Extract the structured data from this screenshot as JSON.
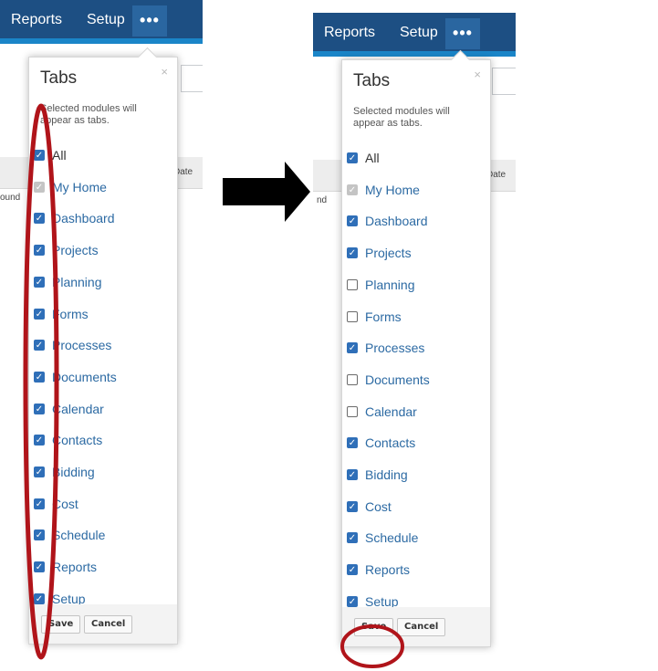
{
  "colors": {
    "navbar": "#1d4f83",
    "navbar_stripe": "#1a85c8",
    "checkbox_checked": "#2f6fb8",
    "link_text": "#2c6aa3",
    "annotation_red": "#b0141a",
    "annotation_arrow": "#000000"
  },
  "left_panel": {
    "navbar": {
      "reports": "Reports",
      "setup": "Setup",
      "more": "•••"
    },
    "bg_fragments": {
      "date": "Date",
      "found": "ound"
    },
    "dropdown": {
      "title": "Tabs",
      "close": "×",
      "description": "Selected modules will appear as tabs.",
      "items": [
        {
          "label": "All",
          "checked": true,
          "disabled": false,
          "link": false
        },
        {
          "label": "My Home",
          "checked": true,
          "disabled": true,
          "link": true
        },
        {
          "label": "Dashboard",
          "checked": true,
          "disabled": false,
          "link": true
        },
        {
          "label": "Projects",
          "checked": true,
          "disabled": false,
          "link": true
        },
        {
          "label": "Planning",
          "checked": true,
          "disabled": false,
          "link": true
        },
        {
          "label": "Forms",
          "checked": true,
          "disabled": false,
          "link": true
        },
        {
          "label": "Processes",
          "checked": true,
          "disabled": false,
          "link": true
        },
        {
          "label": "Documents",
          "checked": true,
          "disabled": false,
          "link": true
        },
        {
          "label": "Calendar",
          "checked": true,
          "disabled": false,
          "link": true
        },
        {
          "label": "Contacts",
          "checked": true,
          "disabled": false,
          "link": true
        },
        {
          "label": "Bidding",
          "checked": true,
          "disabled": false,
          "link": true
        },
        {
          "label": "Cost",
          "checked": true,
          "disabled": false,
          "link": true
        },
        {
          "label": "Schedule",
          "checked": true,
          "disabled": false,
          "link": true
        },
        {
          "label": "Reports",
          "checked": true,
          "disabled": false,
          "link": true
        },
        {
          "label": "Setup",
          "checked": true,
          "disabled": false,
          "link": true
        }
      ],
      "save": "Save",
      "cancel": "Cancel"
    }
  },
  "right_panel": {
    "navbar": {
      "reports": "Reports",
      "setup": "Setup",
      "more": "•••"
    },
    "bg_fragments": {
      "date": "Date",
      "found": "nd"
    },
    "dropdown": {
      "title": "Tabs",
      "close": "×",
      "description": "Selected modules will appear as tabs.",
      "items": [
        {
          "label": "All",
          "checked": true,
          "disabled": false,
          "link": false
        },
        {
          "label": "My Home",
          "checked": true,
          "disabled": true,
          "link": true
        },
        {
          "label": "Dashboard",
          "checked": true,
          "disabled": false,
          "link": true
        },
        {
          "label": "Projects",
          "checked": true,
          "disabled": false,
          "link": true
        },
        {
          "label": "Planning",
          "checked": false,
          "disabled": false,
          "link": true
        },
        {
          "label": "Forms",
          "checked": false,
          "disabled": false,
          "link": true
        },
        {
          "label": "Processes",
          "checked": true,
          "disabled": false,
          "link": true
        },
        {
          "label": "Documents",
          "checked": false,
          "disabled": false,
          "link": true
        },
        {
          "label": "Calendar",
          "checked": false,
          "disabled": false,
          "link": true
        },
        {
          "label": "Contacts",
          "checked": true,
          "disabled": false,
          "link": true
        },
        {
          "label": "Bidding",
          "checked": true,
          "disabled": false,
          "link": true
        },
        {
          "label": "Cost",
          "checked": true,
          "disabled": false,
          "link": true
        },
        {
          "label": "Schedule",
          "checked": true,
          "disabled": false,
          "link": true
        },
        {
          "label": "Reports",
          "checked": true,
          "disabled": false,
          "link": true
        },
        {
          "label": "Setup",
          "checked": true,
          "disabled": false,
          "link": true
        }
      ],
      "save": "Save",
      "cancel": "Cancel"
    }
  },
  "annotations": {
    "left_highlight": "oval-around-checkboxes",
    "right_highlight": "circle-around-save-button",
    "arrow_between": "arrow-right-icon",
    "arrow_side": "arrow-down-turn-icon"
  }
}
